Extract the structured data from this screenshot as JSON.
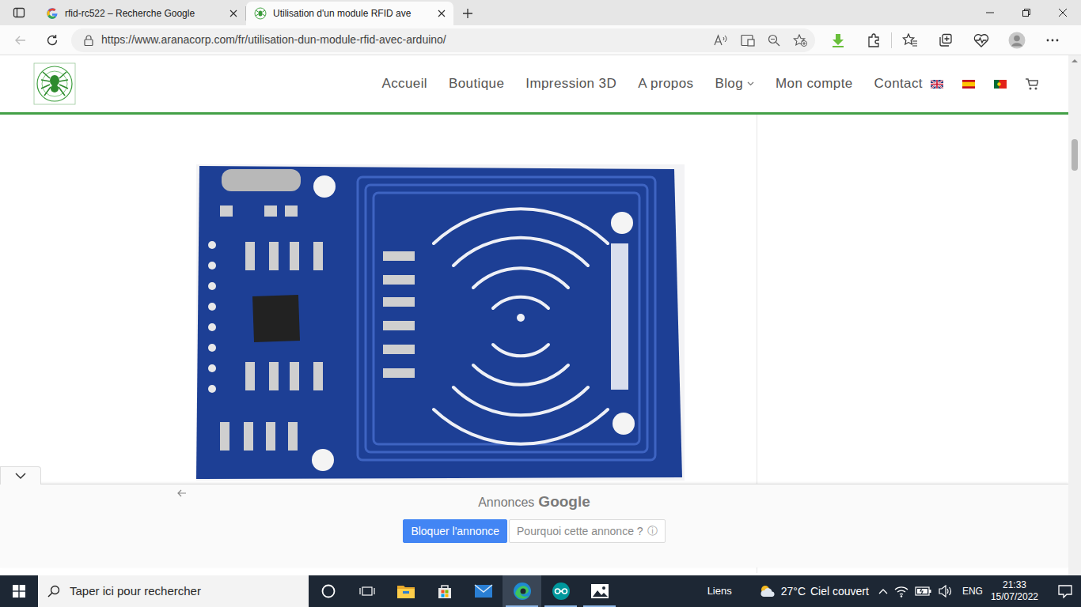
{
  "browser": {
    "tabs": [
      {
        "label": "rfid-rc522 – Recherche Google",
        "selected": false
      },
      {
        "label": "Utilisation d'un module RFID ave",
        "selected": true
      }
    ],
    "url": "https://www.aranacorp.com/fr/utilisation-dun-module-rfid-avec-arduino/"
  },
  "site": {
    "nav": [
      {
        "label": "Accueil",
        "has_menu": false
      },
      {
        "label": "Boutique",
        "has_menu": false
      },
      {
        "label": "Impression 3D",
        "has_menu": false
      },
      {
        "label": "A propos",
        "has_menu": false
      },
      {
        "label": "Blog",
        "has_menu": true
      },
      {
        "label": "Mon compte",
        "has_menu": false
      },
      {
        "label": "Contact",
        "has_menu": false
      }
    ]
  },
  "ad": {
    "label": "Annonces",
    "brand": "Google",
    "block_button": "Bloquer l'annonce",
    "why_button": "Pourquoi cette annonce ?",
    "info_icon": "ⓘ"
  },
  "taskbar": {
    "search_placeholder": "Taper ici pour rechercher",
    "links": "Liens",
    "weather_temp": "27°C",
    "weather_text": "Ciel couvert",
    "language": "ENG",
    "time": "21:33",
    "date": "15/07/2022"
  }
}
